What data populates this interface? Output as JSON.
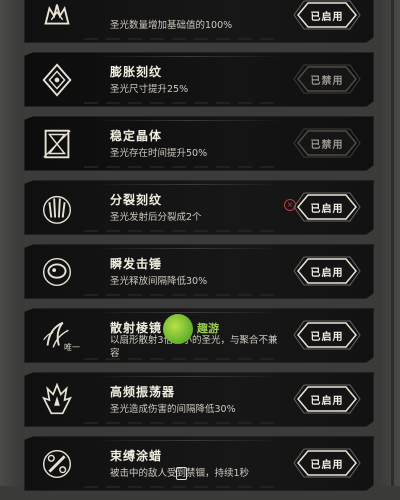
{
  "skills": [
    {
      "id": "first",
      "name": "",
      "desc": "圣光数量增加基础值的100%",
      "status": "已启用",
      "enabled": true,
      "icon": "crown-icon"
    },
    {
      "id": "expand",
      "name": "膨胀刻纹",
      "desc": "圣光尺寸提升25%",
      "status": "已禁用",
      "enabled": false,
      "icon": "diamond-rune-icon"
    },
    {
      "id": "stable",
      "name": "稳定晶体",
      "desc": "圣光存在时间提升50%",
      "status": "已禁用",
      "enabled": false,
      "icon": "hourglass-icon"
    },
    {
      "id": "split",
      "name": "分裂刻纹",
      "desc": "圣光发射后分裂成2个",
      "status": "已启用",
      "enabled": true,
      "icon": "split-claw-icon"
    },
    {
      "id": "burst",
      "name": "瞬发击锤",
      "desc": "圣光释放间隔降低30%",
      "status": "已启用",
      "enabled": true,
      "icon": "hammer-icon"
    },
    {
      "id": "scatter",
      "name": "散射棱镜",
      "desc": "以扇形散射3倍稍小的圣光，与聚合不兼容",
      "status": "已启用",
      "enabled": true,
      "icon": "prism-icon"
    },
    {
      "id": "resonator",
      "name": "高频振荡器",
      "desc": "圣光造成伤害的间隔降低30%",
      "status": "已启用",
      "enabled": true,
      "icon": "flame-icon"
    },
    {
      "id": "bind",
      "name": "束缚涂蜡",
      "desc": "被击中的敌人受到禁锢，持续1秒",
      "status": "已启用",
      "enabled": true,
      "icon": "chain-icon"
    }
  ],
  "watermark": {
    "brand": "趣游",
    "sub": "唯一"
  },
  "accent": "#e9e4d8"
}
